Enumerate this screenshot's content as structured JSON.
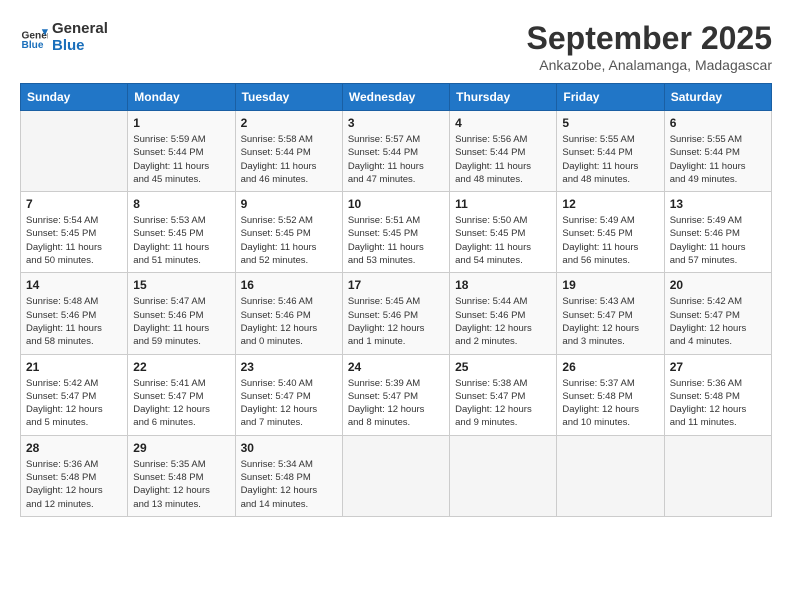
{
  "header": {
    "logo_line1": "General",
    "logo_line2": "Blue",
    "month_title": "September 2025",
    "subtitle": "Ankazobe, Analamanga, Madagascar"
  },
  "weekdays": [
    "Sunday",
    "Monday",
    "Tuesday",
    "Wednesday",
    "Thursday",
    "Friday",
    "Saturday"
  ],
  "weeks": [
    [
      {
        "day": "",
        "info": ""
      },
      {
        "day": "1",
        "info": "Sunrise: 5:59 AM\nSunset: 5:44 PM\nDaylight: 11 hours\nand 45 minutes."
      },
      {
        "day": "2",
        "info": "Sunrise: 5:58 AM\nSunset: 5:44 PM\nDaylight: 11 hours\nand 46 minutes."
      },
      {
        "day": "3",
        "info": "Sunrise: 5:57 AM\nSunset: 5:44 PM\nDaylight: 11 hours\nand 47 minutes."
      },
      {
        "day": "4",
        "info": "Sunrise: 5:56 AM\nSunset: 5:44 PM\nDaylight: 11 hours\nand 48 minutes."
      },
      {
        "day": "5",
        "info": "Sunrise: 5:55 AM\nSunset: 5:44 PM\nDaylight: 11 hours\nand 48 minutes."
      },
      {
        "day": "6",
        "info": "Sunrise: 5:55 AM\nSunset: 5:44 PM\nDaylight: 11 hours\nand 49 minutes."
      }
    ],
    [
      {
        "day": "7",
        "info": "Sunrise: 5:54 AM\nSunset: 5:45 PM\nDaylight: 11 hours\nand 50 minutes."
      },
      {
        "day": "8",
        "info": "Sunrise: 5:53 AM\nSunset: 5:45 PM\nDaylight: 11 hours\nand 51 minutes."
      },
      {
        "day": "9",
        "info": "Sunrise: 5:52 AM\nSunset: 5:45 PM\nDaylight: 11 hours\nand 52 minutes."
      },
      {
        "day": "10",
        "info": "Sunrise: 5:51 AM\nSunset: 5:45 PM\nDaylight: 11 hours\nand 53 minutes."
      },
      {
        "day": "11",
        "info": "Sunrise: 5:50 AM\nSunset: 5:45 PM\nDaylight: 11 hours\nand 54 minutes."
      },
      {
        "day": "12",
        "info": "Sunrise: 5:49 AM\nSunset: 5:45 PM\nDaylight: 11 hours\nand 56 minutes."
      },
      {
        "day": "13",
        "info": "Sunrise: 5:49 AM\nSunset: 5:46 PM\nDaylight: 11 hours\nand 57 minutes."
      }
    ],
    [
      {
        "day": "14",
        "info": "Sunrise: 5:48 AM\nSunset: 5:46 PM\nDaylight: 11 hours\nand 58 minutes."
      },
      {
        "day": "15",
        "info": "Sunrise: 5:47 AM\nSunset: 5:46 PM\nDaylight: 11 hours\nand 59 minutes."
      },
      {
        "day": "16",
        "info": "Sunrise: 5:46 AM\nSunset: 5:46 PM\nDaylight: 12 hours\nand 0 minutes."
      },
      {
        "day": "17",
        "info": "Sunrise: 5:45 AM\nSunset: 5:46 PM\nDaylight: 12 hours\nand 1 minute."
      },
      {
        "day": "18",
        "info": "Sunrise: 5:44 AM\nSunset: 5:46 PM\nDaylight: 12 hours\nand 2 minutes."
      },
      {
        "day": "19",
        "info": "Sunrise: 5:43 AM\nSunset: 5:47 PM\nDaylight: 12 hours\nand 3 minutes."
      },
      {
        "day": "20",
        "info": "Sunrise: 5:42 AM\nSunset: 5:47 PM\nDaylight: 12 hours\nand 4 minutes."
      }
    ],
    [
      {
        "day": "21",
        "info": "Sunrise: 5:42 AM\nSunset: 5:47 PM\nDaylight: 12 hours\nand 5 minutes."
      },
      {
        "day": "22",
        "info": "Sunrise: 5:41 AM\nSunset: 5:47 PM\nDaylight: 12 hours\nand 6 minutes."
      },
      {
        "day": "23",
        "info": "Sunrise: 5:40 AM\nSunset: 5:47 PM\nDaylight: 12 hours\nand 7 minutes."
      },
      {
        "day": "24",
        "info": "Sunrise: 5:39 AM\nSunset: 5:47 PM\nDaylight: 12 hours\nand 8 minutes."
      },
      {
        "day": "25",
        "info": "Sunrise: 5:38 AM\nSunset: 5:47 PM\nDaylight: 12 hours\nand 9 minutes."
      },
      {
        "day": "26",
        "info": "Sunrise: 5:37 AM\nSunset: 5:48 PM\nDaylight: 12 hours\nand 10 minutes."
      },
      {
        "day": "27",
        "info": "Sunrise: 5:36 AM\nSunset: 5:48 PM\nDaylight: 12 hours\nand 11 minutes."
      }
    ],
    [
      {
        "day": "28",
        "info": "Sunrise: 5:36 AM\nSunset: 5:48 PM\nDaylight: 12 hours\nand 12 minutes."
      },
      {
        "day": "29",
        "info": "Sunrise: 5:35 AM\nSunset: 5:48 PM\nDaylight: 12 hours\nand 13 minutes."
      },
      {
        "day": "30",
        "info": "Sunrise: 5:34 AM\nSunset: 5:48 PM\nDaylight: 12 hours\nand 14 minutes."
      },
      {
        "day": "",
        "info": ""
      },
      {
        "day": "",
        "info": ""
      },
      {
        "day": "",
        "info": ""
      },
      {
        "day": "",
        "info": ""
      }
    ]
  ]
}
